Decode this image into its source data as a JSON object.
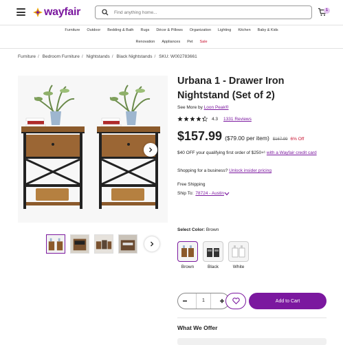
{
  "header": {
    "logo": "wayfair",
    "search_placeholder": "Find anything home...",
    "cart_count": "1"
  },
  "nav": {
    "row1": [
      "Furniture",
      "Outdoor",
      "Bedding & Bath",
      "Rugs",
      "Décor & Pillows",
      "Organization",
      "Lighting",
      "Kitchen",
      "Baby & Kids"
    ],
    "row2": [
      "Renovation",
      "Appliances",
      "Pet"
    ],
    "sale": "Sale"
  },
  "breadcrumb": {
    "items": [
      "Furniture",
      "Bedroom Furniture",
      "Nightstands",
      "Black Nightstands"
    ],
    "sku": "SKU: W002783661"
  },
  "product": {
    "title": "Urbana 1 - Drawer Iron Nightstand (Set of 2)",
    "see_more_prefix": "See More by",
    "brand": "Loon Peak®",
    "rating": "4.3",
    "rating_value": 4.3,
    "reviews": "1331 Reviews",
    "price": "$157.99",
    "per_item": "($79.00 per item)",
    "original_price": "$167.99",
    "discount": "6% Off",
    "promo_text": "$40 OFF your qualifying first order of $250+¹",
    "promo_link": "with a Wayfair credit card",
    "business_text": "Shopping for a business?",
    "business_link": "Unlock insider pricing",
    "shipping": "Free Shipping",
    "ship_to_label": "Ship To:",
    "ship_to_value": "78724 - Austin",
    "select_color_label": "Select Color:",
    "selected_color": "Brown",
    "colors": [
      "Brown",
      "Black",
      "White"
    ],
    "quantity": "1",
    "add_to_cart": "Add to Cart",
    "what_we_offer": "What We Offer"
  },
  "colors": {
    "brand": "#7b189f",
    "sale": "#c8102e"
  }
}
